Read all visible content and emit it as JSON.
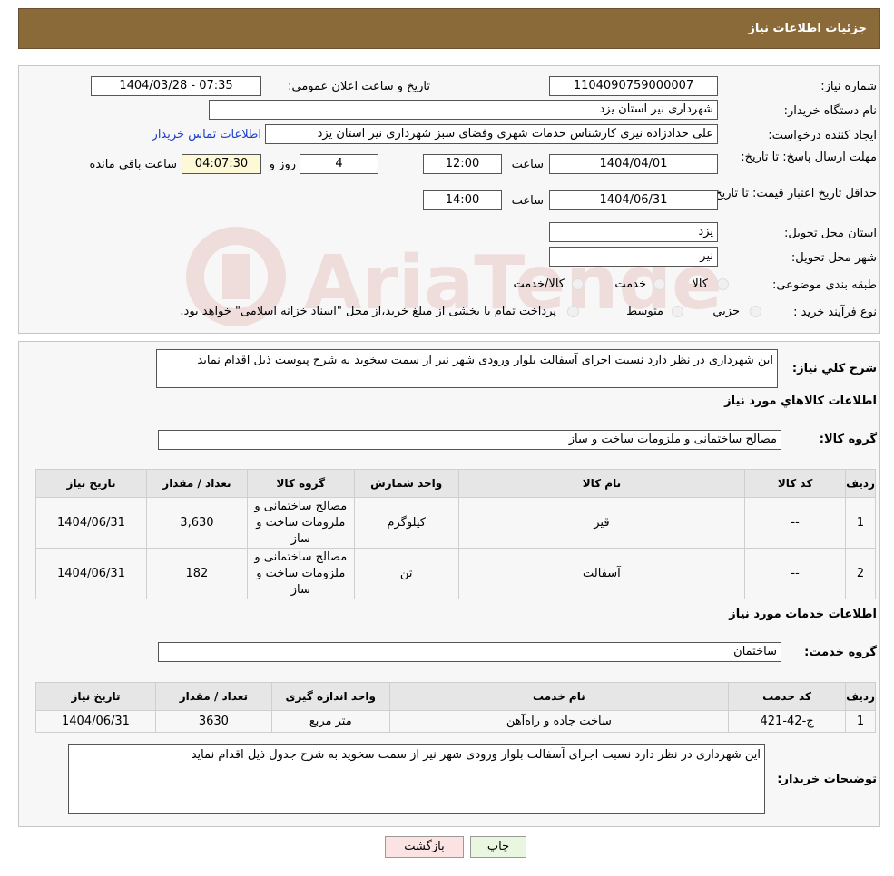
{
  "header": {
    "title": "جزئیات اطلاعات نیاز"
  },
  "fields": {
    "need_number_label": "شماره نیاز:",
    "need_number": "1104090759000007",
    "announce_label": "تاریخ و ساعت اعلان عمومی:",
    "announce_value": "1404/03/28 - 07:35",
    "buyer_org_label": "نام دستگاه خریدار:",
    "buyer_org": "شهرداری نیر استان یزد",
    "creator_label": "ایجاد کننده درخواست:",
    "creator": "علی حدادزاده نیری کارشناس خدمات شهری وفضای سبز شهرداری نیر استان یزد",
    "contact_link": "اطلاعات تماس خریدار",
    "reply_deadline_label": "مهلت ارسال پاسخ: تا تاریخ:",
    "reply_date": "1404/04/01",
    "time_label": "ساعت",
    "reply_time": "12:00",
    "days_value": "4",
    "days_label": "روز و",
    "remaining_time": "04:07:30",
    "remaining_label": "ساعت باقي مانده",
    "price_validity_label": "حداقل تاریخ اعتبار قیمت: تا تاریخ:",
    "price_date": "1404/06/31",
    "price_time": "14:00",
    "province_label": "استان محل تحویل:",
    "province": "یزد",
    "city_label": "شهر محل تحویل:",
    "city": "نیر",
    "category_label": "طبقه بندی موضوعی:",
    "category_options": [
      "کالا",
      "خدمت",
      "کالا/خدمت"
    ],
    "process_label": "نوع فرآیند خرید :",
    "process_options": [
      "جزیي",
      "متوسط"
    ],
    "process_note": "پرداخت تمام یا بخشی از مبلغ خرید،از محل \"اسناد خزانه اسلامی\" خواهد بود."
  },
  "description": {
    "label": "شرح کلي نياز:",
    "text": "این شهرداری در نظر دارد نسبت اجرای آسفالت بلوار ورودی شهر نیر از سمت سخوید  به شرح پیوست ذیل اقدام نماید"
  },
  "goods": {
    "title": "اطلاعات کالاهاي مورد نياز",
    "group_label": "گروه کالا:",
    "group_value": "مصالح ساختمانی و ملزومات ساخت و ساز",
    "columns": [
      "ردیف",
      "کد کالا",
      "نام کالا",
      "واحد شمارش",
      "گروه کالا",
      "تعداد / مقدار",
      "تاریخ نیاز"
    ],
    "rows": [
      {
        "idx": "1",
        "code": "--",
        "name": "قیر",
        "unit": "کیلوگرم",
        "group": "مصالح ساختمانی و ملزومات ساخت و ساز",
        "qty": "3,630",
        "date": "1404/06/31"
      },
      {
        "idx": "2",
        "code": "--",
        "name": "آسفالت",
        "unit": "تن",
        "group": "مصالح ساختمانی و ملزومات ساخت و ساز",
        "qty": "182",
        "date": "1404/06/31"
      }
    ]
  },
  "services": {
    "title": "اطلاعات خدمات مورد نياز",
    "group_label": "گروه خدمت:",
    "group_value": "ساختمان",
    "columns": [
      "ردیف",
      "کد خدمت",
      "نام خدمت",
      "واحد اندازه گیری",
      "تعداد / مقدار",
      "تاریخ نیاز"
    ],
    "rows": [
      {
        "idx": "1",
        "code": "ج-42-421",
        "name": "ساخت جاده و راه‌آهن",
        "unit": "متر مربع",
        "qty": "3630",
        "date": "1404/06/31"
      }
    ]
  },
  "buyer_notes": {
    "label": "توضیحات خریدار:",
    "text": "این شهرداری در نظر دارد نسبت اجرای آسفالت بلوار ورودی شهر نیر از سمت سخوید  به شرح جدول ذیل  اقدام نماید"
  },
  "buttons": {
    "print": "چاپ",
    "back": "بازگشت"
  },
  "watermark": {
    "text": "AriaTender.neT"
  },
  "colors": {
    "header": "#8b6a3a",
    "link": "#1a3fcc",
    "back_button": "#fbe3e3",
    "print_button": "#eaf7e0"
  }
}
